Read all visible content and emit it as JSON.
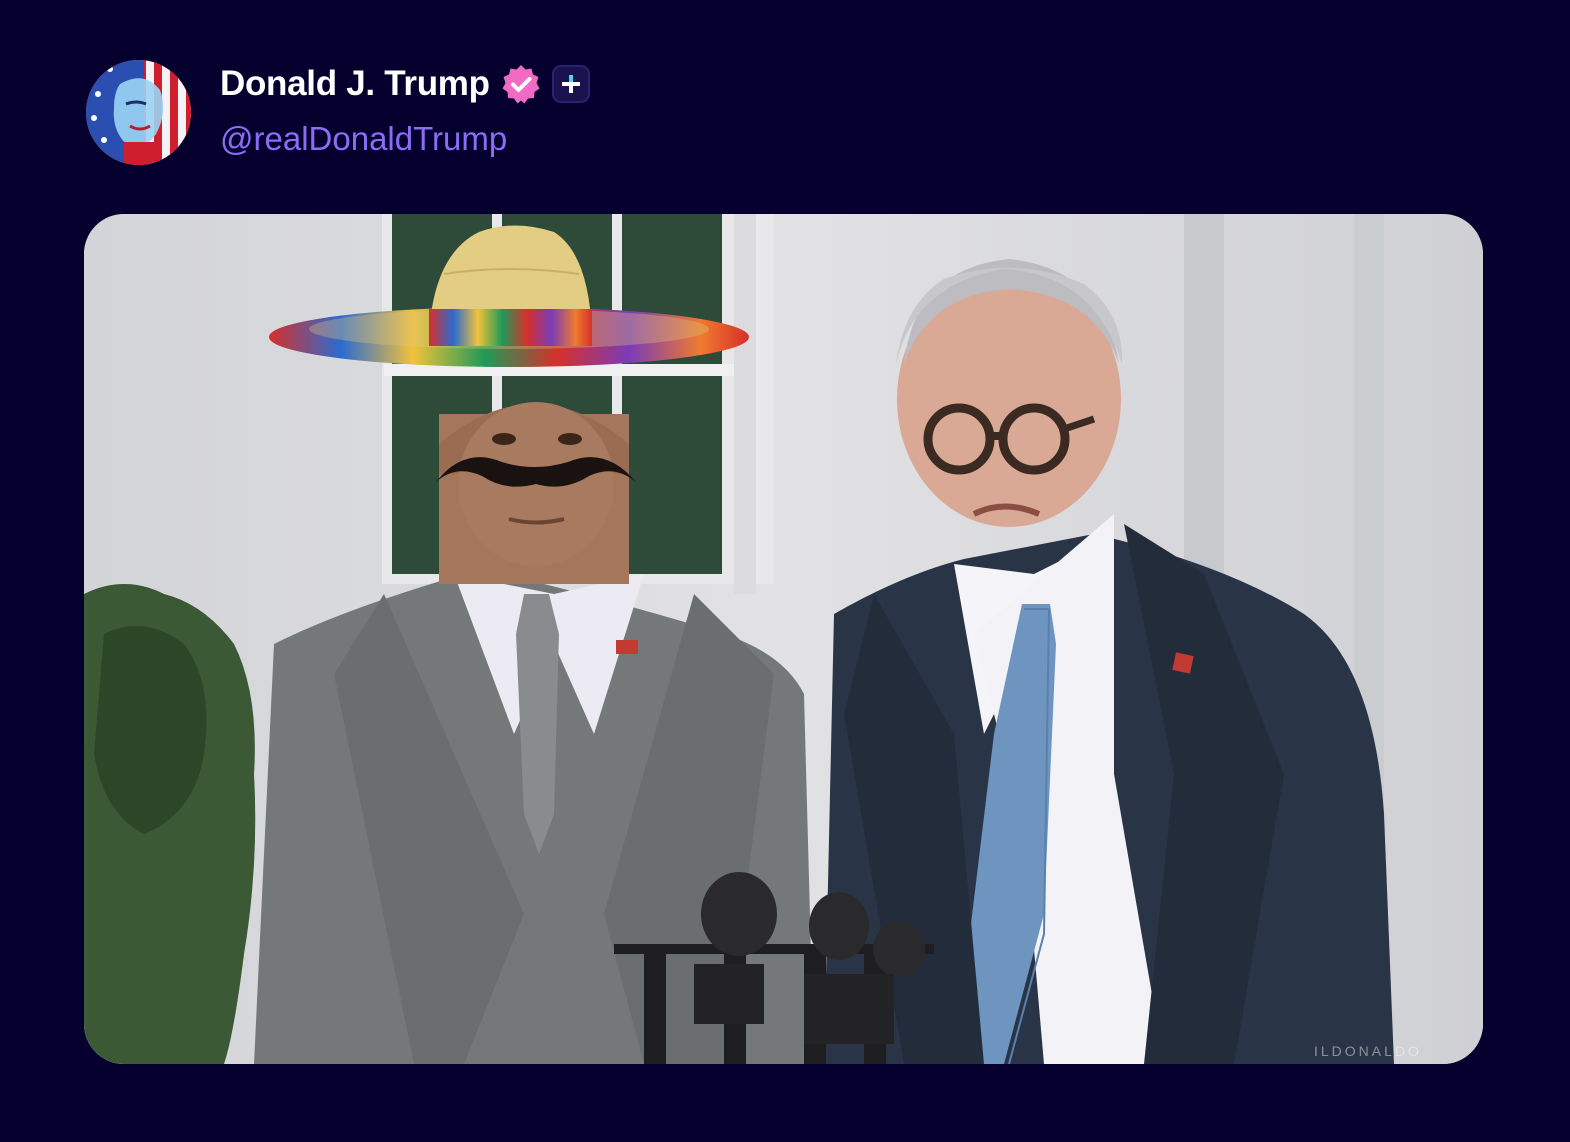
{
  "post": {
    "author": {
      "display_name": "Donald J. Trump",
      "handle": "@realDonaldTrump",
      "avatar": "avatar-flag-portrait",
      "verified_icon": "verified-badge-icon",
      "plus_icon": "plus-badge-icon"
    },
    "media": {
      "type": "image",
      "watermark": "ILDONALDO"
    }
  },
  "colors": {
    "background": "#05002e",
    "display_name": "#ffffff",
    "handle": "#8b6cf5",
    "verified_badge": "#ef6bc4"
  }
}
